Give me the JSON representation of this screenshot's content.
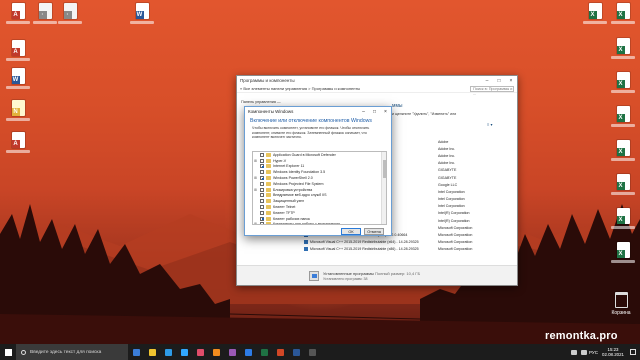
{
  "desktop": {
    "icons_left": [
      {
        "type": "pdf",
        "label": ""
      },
      {
        "type": "word",
        "label": ""
      },
      {
        "type": "file",
        "label": ""
      },
      {
        "type": "word",
        "label": ""
      },
      {
        "type": "note",
        "label": ""
      },
      {
        "type": "pdf",
        "label": ""
      }
    ],
    "icons_top": [
      {
        "type": "file",
        "label": ""
      },
      {
        "type": "file",
        "label": ""
      },
      {
        "type": "word",
        "label": ""
      }
    ],
    "icons_right": [
      {
        "type": "excel",
        "label": ""
      },
      {
        "type": "excel",
        "label": ""
      },
      {
        "type": "excel",
        "label": ""
      },
      {
        "type": "excel",
        "label": ""
      },
      {
        "type": "excel",
        "label": ""
      },
      {
        "type": "excel",
        "label": ""
      },
      {
        "type": "excel",
        "label": ""
      },
      {
        "type": "excel",
        "label": ""
      }
    ],
    "recycle_bin_label": "Корзина"
  },
  "control_panel": {
    "title": "Программы и компоненты",
    "address": "«  Все элементы панели управления  >  Программы и компоненты",
    "search_placeholder": "Поиск в: Программы и ...",
    "side_link": "Панель управления —",
    "heading": "ммы",
    "hint": "и щелкните \"Удалить\", \"Изменить\" или",
    "sort_label": "≡ ▾",
    "rows": [
      {
        "name": "",
        "publisher": "Adobe",
        "date": ""
      },
      {
        "name": "",
        "publisher": "Adobe Inc.",
        "date": ""
      },
      {
        "name": "",
        "publisher": "Adobe Inc.",
        "date": ""
      },
      {
        "name": "",
        "publisher": "Adobe Inc.",
        "date": ""
      },
      {
        "name": "",
        "publisher": "GIGABYTE",
        "date": ""
      },
      {
        "name": "",
        "publisher": "GIGABYTE",
        "date": ""
      },
      {
        "name": "",
        "publisher": "Google LLC",
        "date": ""
      },
      {
        "name": "",
        "publisher": "Intel Corporation",
        "date": ""
      },
      {
        "name": "",
        "publisher": "Intel Corporation",
        "date": ""
      },
      {
        "name": "",
        "publisher": "Intel Corporation",
        "date": ""
      },
      {
        "name": "",
        "publisher": "Intel(R) Corporation",
        "date": ""
      },
      {
        "name": "",
        "publisher": "Intel(R) Corporation",
        "date": ""
      },
      {
        "name": "Microsoft OneDrive",
        "publisher": "Microsoft Corporation",
        "date": ""
      },
      {
        "name": "Microsoft Visual C++ 2013 Redistributable (x64) - 12.0.40664",
        "publisher": "Microsoft Corporation",
        "date": ""
      },
      {
        "name": "Microsoft Visual C++ 2015-2019 Redistributable (x64) - 14.28.29325",
        "publisher": "Microsoft Corporation",
        "date": ""
      },
      {
        "name": "Microsoft Visual C++ 2015-2019 Redistributable (x86) - 14.28.29325",
        "publisher": "Microsoft Corporation",
        "date": ""
      }
    ],
    "status_title": "Установленные программы",
    "status_size": "Полный размер: 10,4 ГБ",
    "status_count": "Установлено программ: 38"
  },
  "features_dialog": {
    "title": "Компоненты Windows",
    "heading": "Включение или отключение компонентов Windows",
    "description": "Чтобы включить компонент, установите его флажок. Чтобы отключить компонент, снимите его флажок. Затемненный флажок означает, что компонент включен частично.",
    "items": [
      {
        "label": "Application Guard в Microsoft Defender",
        "expand": "",
        "checked": false
      },
      {
        "label": "Hyper-V",
        "expand": "⊞",
        "checked": false
      },
      {
        "label": "Internet Explorer 11",
        "expand": "",
        "checked": true
      },
      {
        "label": "Windows Identity Foundation 3.5",
        "expand": "",
        "checked": false
      },
      {
        "label": "Windows PowerShell 2.0",
        "expand": "⊞",
        "checked": true
      },
      {
        "label": "Windows Projected File System",
        "expand": "",
        "checked": false
      },
      {
        "label": "Блокировка устройства",
        "expand": "⊞",
        "checked": false
      },
      {
        "label": "Внедряемое веб-ядро служб IIS",
        "expand": "",
        "checked": false
      },
      {
        "label": "Защищенный узел",
        "expand": "",
        "checked": false
      },
      {
        "label": "Клиент Telnet",
        "expand": "",
        "checked": false
      },
      {
        "label": "Клиент TFTP",
        "expand": "",
        "checked": false
      },
      {
        "label": "Клиент рабочих папок",
        "expand": "",
        "checked": true
      },
      {
        "label": "Компоненты для работы с мультимедиа",
        "expand": "⊞",
        "checked": true
      }
    ],
    "ok_label": "ОК",
    "cancel_label": "Отмена"
  },
  "watermark": "remontka.pro",
  "taskbar": {
    "search_placeholder": "Введите здесь текст для поиска",
    "apps": [
      "#3b7dd8",
      "#f0c430",
      "#2e9be6",
      "#31a8ff",
      "#e04d6a",
      "#f28c1e",
      "#9b59b6",
      "#2d7be5",
      "#1f7244",
      "#d24726",
      "#2b5797",
      "#555555"
    ],
    "language": "РУС",
    "time": "15:23",
    "date": "02.08.2021"
  },
  "colors": {
    "accent": "#1f5ea8",
    "taskbar": "#1c1c1c",
    "wallpaper_sky": "#d84f29"
  }
}
